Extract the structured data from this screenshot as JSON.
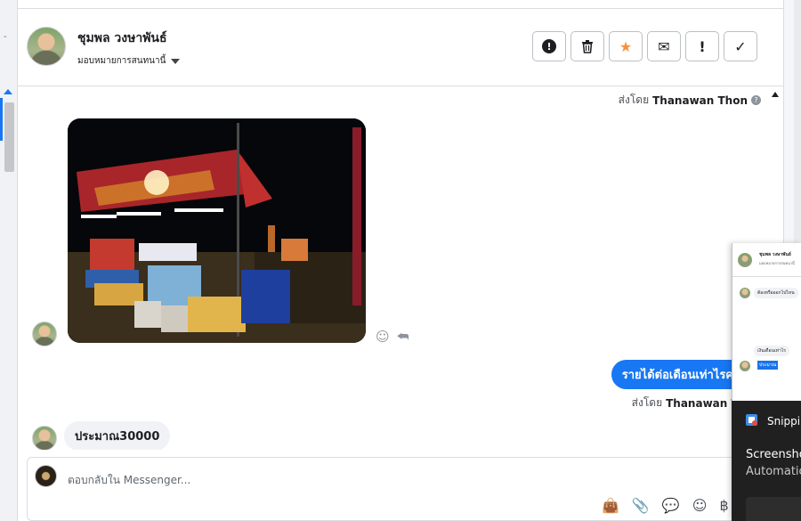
{
  "header": {
    "contact_name": "ชุมพล วงษาพันธ์",
    "assign_label": "มอบหมายการสนทนานี้",
    "actions": [
      {
        "name": "report-button",
        "icon": "exclamation-circle-icon"
      },
      {
        "name": "delete-button",
        "icon": "trash-icon"
      },
      {
        "name": "star-button",
        "icon": "star-icon"
      },
      {
        "name": "mark-unread-button",
        "icon": "envelope-icon"
      },
      {
        "name": "spam-button",
        "icon": "exclamation-icon"
      },
      {
        "name": "done-button",
        "icon": "check-icon"
      }
    ],
    "icons": {
      "report": "!",
      "delete": "🗑",
      "star": "★",
      "unread": "✉",
      "spam": "!",
      "done": "✓"
    }
  },
  "messages": {
    "sent_by_prefix": "ส่งโดย",
    "sent_by_name": "Thanawan Thon",
    "outgoing_text": "รายได้ต่อเดือนเท่าไรคะ",
    "incoming_text": "ประมาณ30000",
    "react_icon": "☺",
    "reply_icon": "⮪"
  },
  "composer": {
    "placeholder": "ตอบกลับใน Messenger...",
    "tools": {
      "bag": "👜",
      "attach": "📎",
      "saved": "💬",
      "emoji": "☺",
      "currency": "฿"
    }
  },
  "overlay": {
    "name": "ชุมพล วงษาพันธ์",
    "sub": "มอบหมายการสนทนานี้",
    "bubble1": "ต้องหรือออกไปไหน",
    "bubble2": "เงินเดือนเท่าไร",
    "selected": "ประมาณ"
  },
  "snip": {
    "title": "Snippin",
    "line1": "Screensho",
    "line2": "Automatic"
  },
  "left_strip": {
    "tick": "-"
  }
}
